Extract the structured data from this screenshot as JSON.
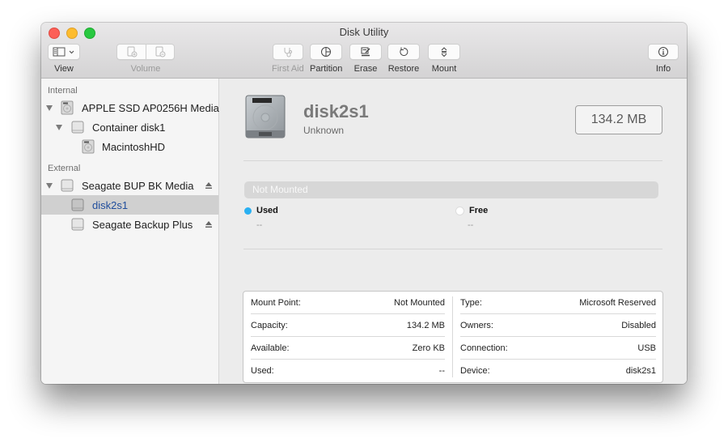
{
  "window": {
    "title": "Disk Utility"
  },
  "toolbar": {
    "view": {
      "label": "View",
      "icon": "sidebar-icon",
      "enabled": true
    },
    "volume": {
      "label": "Volume",
      "enabled": false,
      "buttons": [
        {
          "icon": "add-volume-icon"
        },
        {
          "icon": "remove-volume-icon"
        }
      ]
    },
    "first_aid": {
      "label": "First Aid",
      "icon": "stethoscope-icon",
      "enabled": false
    },
    "partition": {
      "label": "Partition",
      "icon": "pie-chart-icon",
      "enabled": true
    },
    "erase": {
      "label": "Erase",
      "icon": "erase-icon",
      "enabled": true
    },
    "restore": {
      "label": "Restore",
      "icon": "restore-icon",
      "enabled": true
    },
    "mount": {
      "label": "Mount",
      "icon": "mount-icon",
      "enabled": true
    },
    "info": {
      "label": "Info",
      "icon": "info-icon",
      "enabled": true
    }
  },
  "sidebar": {
    "sections": [
      {
        "header": "Internal",
        "items": [
          {
            "label": "APPLE SSD AP0256H Media",
            "level": 0,
            "expanded": true,
            "icon": "internal-disk-icon"
          },
          {
            "label": "Container disk1",
            "level": 1,
            "expanded": true,
            "icon": "external-disk-icon"
          },
          {
            "label": "MacintoshHD",
            "level": 2,
            "icon": "internal-disk-icon"
          }
        ]
      },
      {
        "header": "External",
        "items": [
          {
            "label": "Seagate BUP BK Media",
            "level": 0,
            "expanded": true,
            "icon": "external-disk-icon",
            "ejectable": true
          },
          {
            "label": "disk2s1",
            "level": 1,
            "selected": true,
            "icon": "external-disk-icon"
          },
          {
            "label": "Seagate Backup Plus",
            "level": 1,
            "icon": "external-disk-icon",
            "ejectable": true
          }
        ]
      }
    ]
  },
  "detail": {
    "name": "disk2s1",
    "subtitle": "Unknown",
    "size": "134.2 MB",
    "usage_bar_text": "Not Mounted",
    "legend": [
      {
        "label": "Used",
        "value": "--",
        "color": "#29b0f2"
      },
      {
        "label": "Free",
        "value": "--",
        "color": "#ffffff"
      }
    ],
    "info_left": [
      {
        "key": "Mount Point:",
        "value": "Not Mounted"
      },
      {
        "key": "Capacity:",
        "value": "134.2 MB"
      },
      {
        "key": "Available:",
        "value": "Zero KB"
      },
      {
        "key": "Used:",
        "value": "--"
      }
    ],
    "info_right": [
      {
        "key": "Type:",
        "value": "Microsoft Reserved"
      },
      {
        "key": "Owners:",
        "value": "Disabled"
      },
      {
        "key": "Connection:",
        "value": "USB"
      },
      {
        "key": "Device:",
        "value": "disk2s1"
      }
    ]
  }
}
